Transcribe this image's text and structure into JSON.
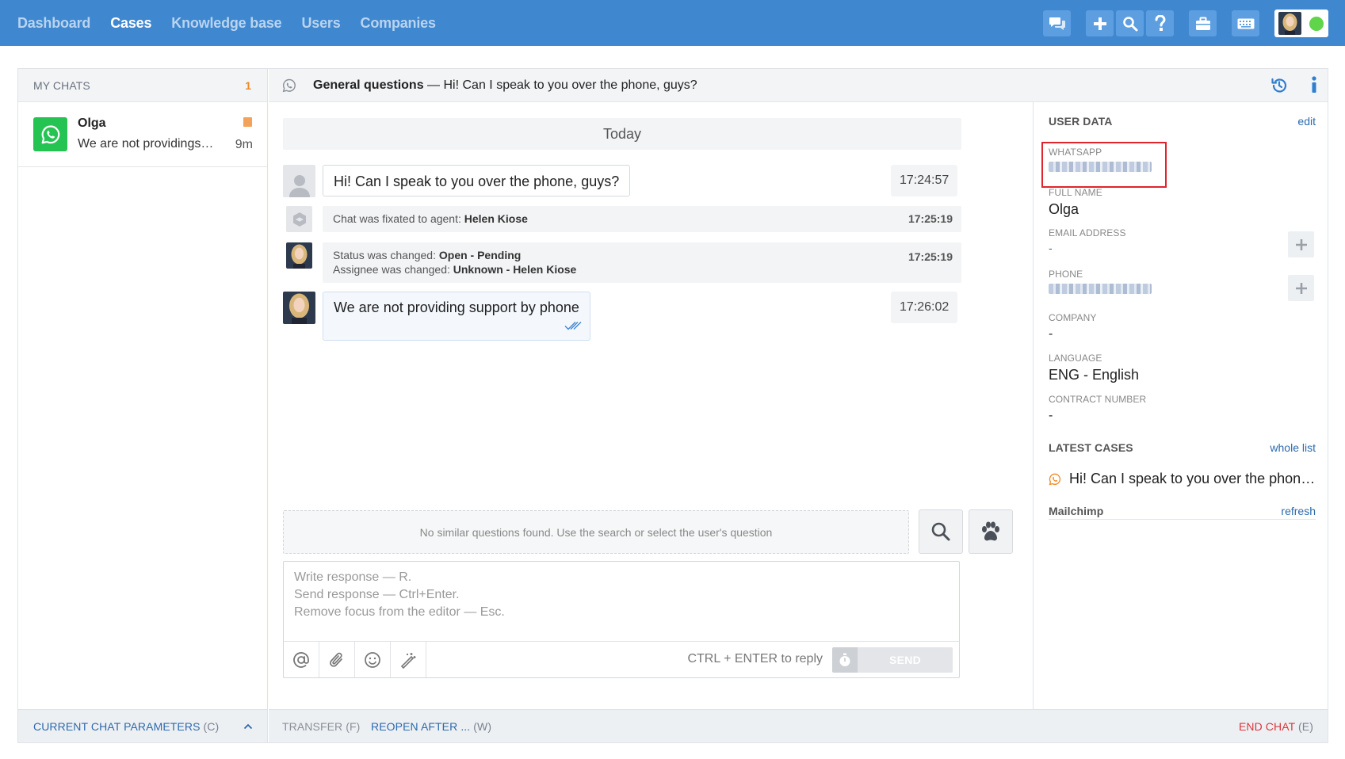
{
  "nav": {
    "items": [
      "Dashboard",
      "Cases",
      "Knowledge base",
      "Users",
      "Companies"
    ],
    "active": "Cases"
  },
  "left": {
    "header_title": "MY CHATS",
    "count": "1",
    "chat": {
      "name": "Olga",
      "preview": "We are not providingsu...",
      "time": "9m",
      "channel_icon": "whatsapp-icon"
    },
    "footer_label": "CURRENT CHAT PARAMETERS",
    "footer_key": "(C)"
  },
  "chat_header": {
    "subject": "General questions",
    "separator": "—",
    "first_message": "Hi! Can I speak to you over the phone, guys?"
  },
  "conversation": {
    "day": "Today",
    "messages": [
      {
        "text": "Hi! Can I speak to you over the phone, guys?",
        "time": "17:24:57"
      },
      {
        "prefix": "Chat was fixated to agent:",
        "bold": "Helen Kiose",
        "time": "17:25:19"
      },
      {
        "line1_prefix": "Status was changed:",
        "line1_bold": "Open - Pending",
        "line2_prefix": "Assignee was changed:",
        "line2_bold": "Unknown - Helen Kiose",
        "time": "17:25:19"
      },
      {
        "text": "We are not providing support by phone",
        "time": "17:26:02"
      }
    ],
    "suggestions": "No similar questions found. Use the search or select the user's question",
    "editor_placeholder": [
      "Write response — R.",
      "Send response — Ctrl+Enter.",
      "Remove focus from the editor — Esc."
    ],
    "reply_hint": "CTRL + ENTER to reply",
    "send_label": "SEND"
  },
  "bottom_bar": {
    "transfer": "TRANSFER",
    "transfer_key": "(F)",
    "reopen": "REOPEN AFTER ...",
    "reopen_key": "(W)",
    "end_chat": "END CHAT",
    "end_chat_key": "(E)"
  },
  "user_data": {
    "title": "USER DATA",
    "edit": "edit",
    "whatsapp_label": "WHATSAPP",
    "full_name_label": "FULL NAME",
    "full_name": "Olga",
    "email_label": "EMAIL ADDRESS",
    "email": "-",
    "phone_label": "PHONE",
    "company_label": "COMPANY",
    "company": "-",
    "language_label": "LANGUAGE",
    "language": "ENG - English",
    "contract_label": "CONTRACT NUMBER",
    "contract": "-"
  },
  "latest_cases": {
    "title": "LATEST CASES",
    "link": "whole list",
    "items": [
      "Hi! Can I speak to you over the phone, guys?"
    ]
  },
  "mailchimp": {
    "title": "Mailchimp",
    "link": "refresh"
  },
  "colors": {
    "topbar": "#3f87cf",
    "accent_link": "#2c6aad",
    "whatsapp": "#25c352",
    "end_chat": "#d9363e",
    "highlight": "#e0242e",
    "count": "#f08a24"
  }
}
